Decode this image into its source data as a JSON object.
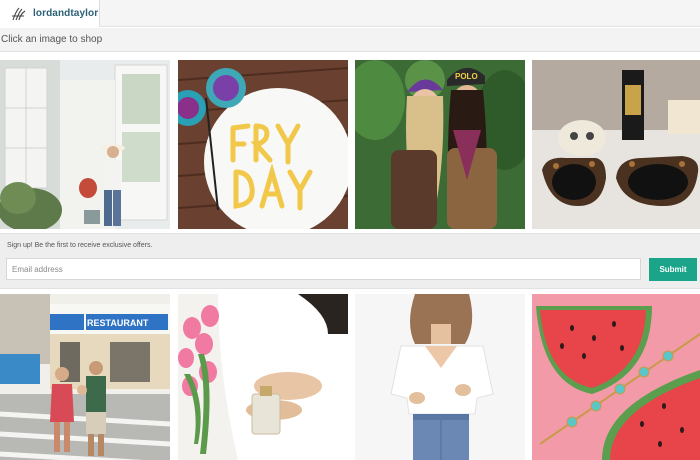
{
  "brand": {
    "name": "lordandtaylor",
    "logo_icon": "lordandtaylor-logo-icon"
  },
  "instruction": "Click an image to shop",
  "signup": {
    "prompt": "Sign up! Be the first to receive exclusive offers.",
    "email_placeholder": "Email address",
    "email_value": "",
    "submit_label": "Submit"
  },
  "gallery": {
    "row1": [
      {
        "id": "photo-woman-by-white-door"
      },
      {
        "id": "photo-fry-day-plate"
      },
      {
        "id": "photo-two-girls-beanies"
      },
      {
        "id": "photo-tortoise-sunglasses"
      }
    ],
    "row2": [
      {
        "id": "photo-family-restaurant-street",
        "sign_text": "RESTAURANT"
      },
      {
        "id": "photo-tulips-perfume"
      },
      {
        "id": "photo-white-tee-jeans"
      },
      {
        "id": "photo-watermelon-bracelet"
      }
    ]
  },
  "colors": {
    "accent": "#1aa58a",
    "brand_text": "#2b5f75"
  }
}
